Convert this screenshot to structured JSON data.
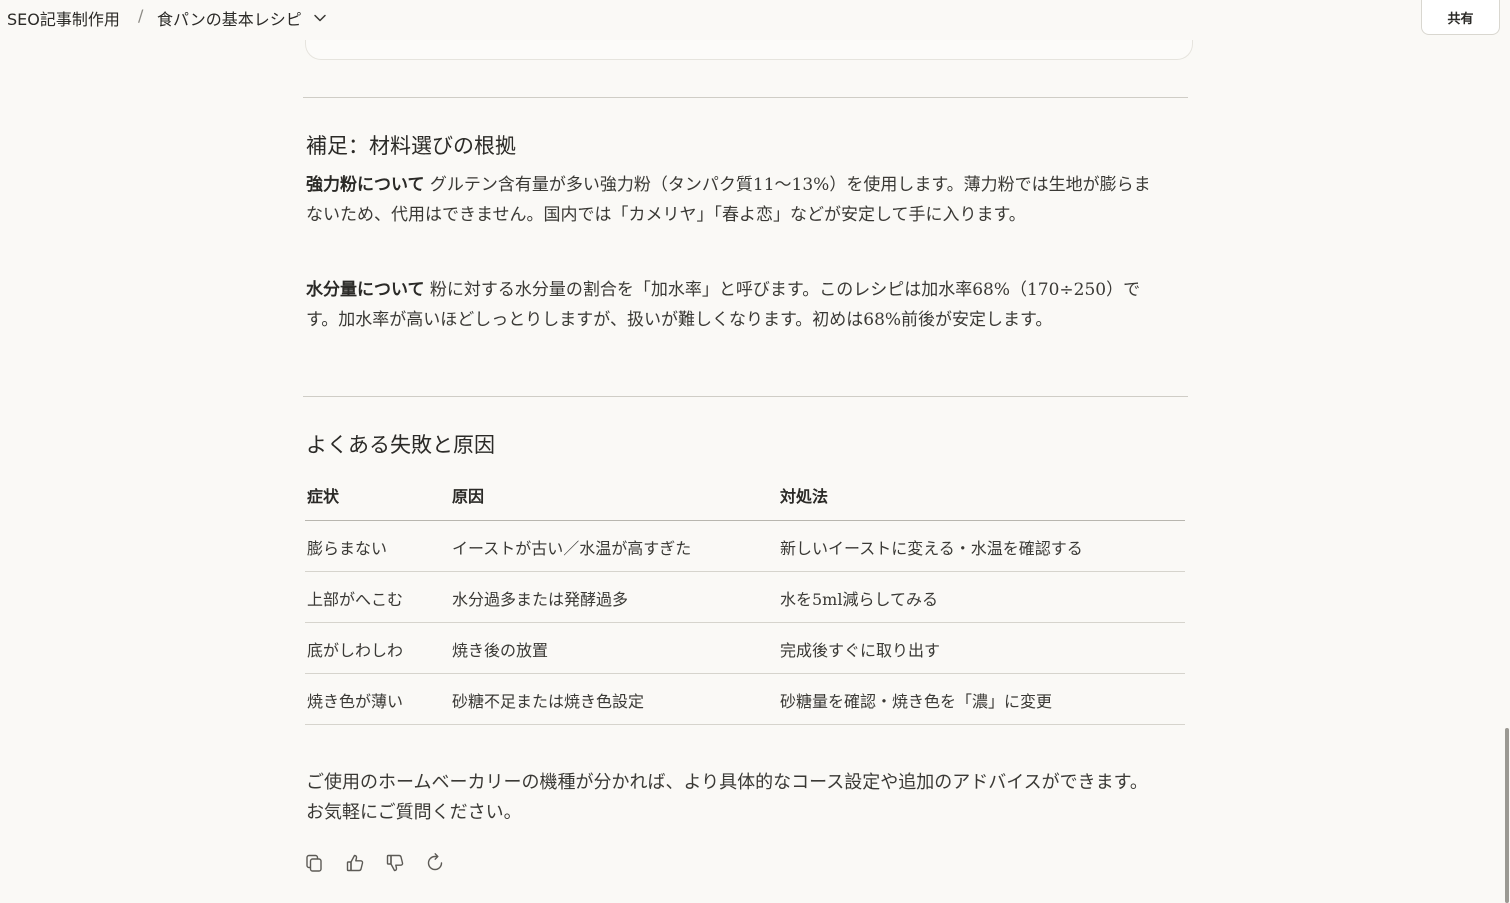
{
  "header": {
    "project": "SEO記事制作用",
    "separator": "/",
    "chat_title": "食パンの基本レシピ",
    "share_label": "共有"
  },
  "supplement": {
    "heading": "補足：材料選びの根拠",
    "flour_label": "強力粉について",
    "flour_text": " グルテン含有量が多い強力粉（タンパク質11〜13%）を使用します。薄力粉では生地が膨らまないため、代用はできません。国内では「カメリヤ」「春よ恋」などが安定して手に入ります。",
    "water_label": "水分量について",
    "water_text": " 粉に対する水分量の割合を「加水率」と呼びます。このレシピは加水率68%（170÷250）です。加水率が高いほどしっとりしますが、扱いが難しくなります。初めは68%前後が安定します。"
  },
  "failures": {
    "heading": "よくある失敗と原因",
    "columns": [
      "症状",
      "原因",
      "対処法"
    ],
    "rows": [
      [
        "膨らまない",
        "イーストが古い／水温が高すぎた",
        "新しいイーストに変える・水温を確認する"
      ],
      [
        "上部がへこむ",
        "水分過多または発酵過多",
        "水を5ml減らしてみる"
      ],
      [
        "底がしわしわ",
        "焼き後の放置",
        "完成後すぐに取り出す"
      ],
      [
        "焼き色が薄い",
        "砂糖不足または焼き色設定",
        "砂糖量を確認・焼き色を「濃」に変更"
      ]
    ]
  },
  "closing": "ご使用のホームベーカリーの機種が分かれば、より具体的なコース設定や追加のアドバイスができます。お気軽にご質問ください。",
  "actions": [
    "copy-icon",
    "thumbs-up-icon",
    "thumbs-down-icon",
    "retry-icon"
  ]
}
